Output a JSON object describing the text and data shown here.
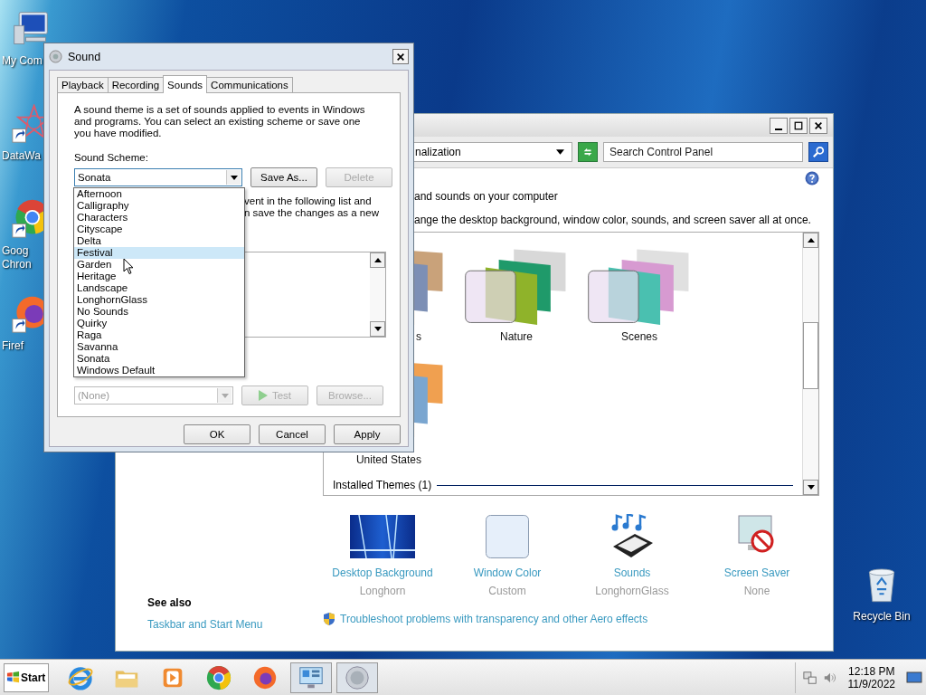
{
  "desktop_icons": [
    {
      "kind": "computer",
      "shortcut": false,
      "lines": [
        "My Com"
      ]
    },
    {
      "kind": "star",
      "shortcut": true,
      "lines": [
        "DataWa"
      ]
    },
    {
      "kind": "chrome",
      "shortcut": true,
      "lines": [
        "Goog",
        "Chron"
      ]
    },
    {
      "kind": "firefox",
      "shortcut": true,
      "lines": [
        "Firef"
      ]
    }
  ],
  "recycle_bin": {
    "label": "Recycle Bin"
  },
  "control_panel": {
    "address": "nalization",
    "search": {
      "placeholder": "Search Control Panel"
    },
    "heading": "and sounds on your computer",
    "description": "ange the desktop background, window color, sounds, and screen saver all at once.",
    "theme_rows": [
      [
        {
          "kind": "landscape",
          "label": "s"
        },
        {
          "kind": "nature",
          "label": "Nature"
        },
        {
          "kind": "scenes",
          "label": "Scenes"
        }
      ],
      [
        {
          "kind": "sunset",
          "label": "United States"
        }
      ]
    ],
    "installed_group": "Installed Themes (1)",
    "settings": [
      {
        "kind": "background",
        "label": "Desktop Background",
        "value": "Longhorn"
      },
      {
        "kind": "color",
        "label": "Window Color",
        "value": "Custom"
      },
      {
        "kind": "sounds",
        "label": "Sounds",
        "value": "LonghornGlass"
      },
      {
        "kind": "saver",
        "label": "Screen Saver",
        "value": "None"
      }
    ],
    "see_also": {
      "title": "See also",
      "links": [
        "Taskbar and Start Menu"
      ]
    },
    "troubleshoot": "Troubleshoot problems with transparency and other Aero effects"
  },
  "sound_dialog": {
    "title": "Sound",
    "tabs": [
      {
        "label": "Playback",
        "selected": false
      },
      {
        "label": "Recording",
        "selected": false
      },
      {
        "label": "Sounds",
        "selected": true
      },
      {
        "label": "Communications",
        "selected": false
      }
    ],
    "intro": "A sound theme is a set of sounds applied to events in Windows and programs.  You can select an existing scheme or save one you have modified.",
    "scheme_label": "Sound Scheme:",
    "scheme": {
      "value": "Sonata",
      "expanded": true,
      "options": [
        {
          "label": "Afternoon",
          "highlighted": false
        },
        {
          "label": "Calligraphy",
          "highlighted": false
        },
        {
          "label": "Characters",
          "highlighted": false
        },
        {
          "label": "Cityscape",
          "highlighted": false
        },
        {
          "label": "Delta",
          "highlighted": false
        },
        {
          "label": "Festival",
          "highlighted": true
        },
        {
          "label": "Garden",
          "highlighted": false
        },
        {
          "label": "Heritage",
          "highlighted": false
        },
        {
          "label": "Landscape",
          "highlighted": false
        },
        {
          "label": "LonghornGlass",
          "highlighted": false
        },
        {
          "label": "No Sounds",
          "highlighted": false
        },
        {
          "label": "Quirky",
          "highlighted": false
        },
        {
          "label": "Raga",
          "highlighted": false
        },
        {
          "label": "Savanna",
          "highlighted": false
        },
        {
          "label": "Sonata",
          "highlighted": false
        },
        {
          "label": "Windows Default",
          "highlighted": false
        }
      ]
    },
    "scheme_buttons": [
      {
        "label": "Save As...",
        "disabled": false
      },
      {
        "label": "Delete",
        "disabled": true
      }
    ],
    "partial_text": [
      "vent in the following list and",
      "n save the changes as a new"
    ],
    "sound_select": {
      "value": "(None)",
      "disabled": true
    },
    "sound_buttons": [
      {
        "kind": "test",
        "label": "Test",
        "disabled": true
      },
      {
        "kind": "plain",
        "label": "Browse...",
        "disabled": true
      }
    ],
    "footer_buttons": [
      "OK",
      "Cancel",
      "Apply"
    ]
  },
  "taskbar": {
    "start": "Start",
    "apps": [
      {
        "kind": "ie",
        "active": false
      },
      {
        "kind": "folder",
        "active": false
      },
      {
        "kind": "media",
        "active": false
      },
      {
        "kind": "chrome",
        "active": false
      },
      {
        "kind": "firefox",
        "active": false
      },
      {
        "kind": "panel",
        "active": true
      },
      {
        "kind": "speaker",
        "active": true
      }
    ],
    "time": "12:18 PM",
    "date": "11/9/2022"
  }
}
